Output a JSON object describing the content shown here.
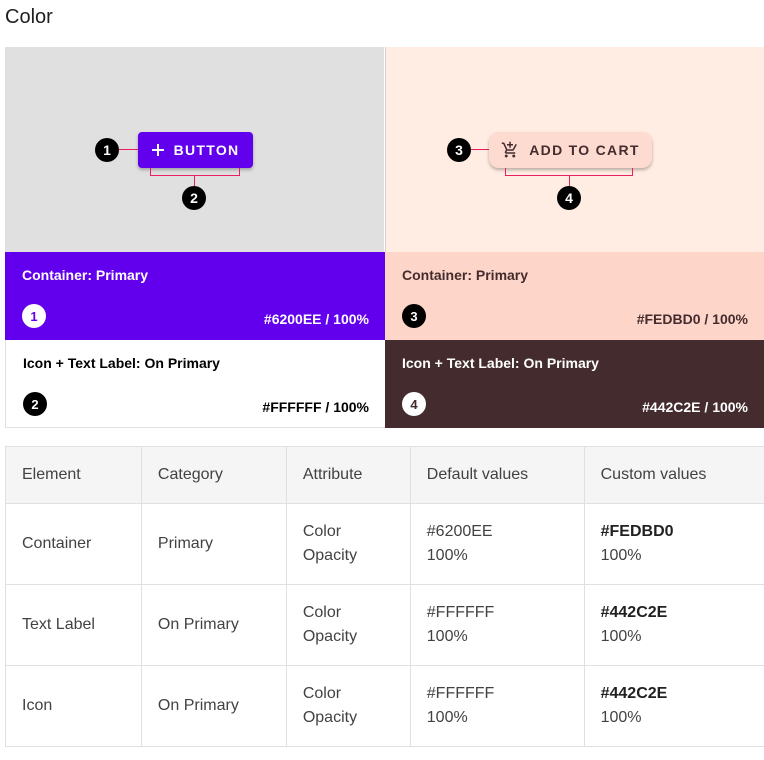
{
  "title": "Color",
  "demo": {
    "primary_button_label": "BUTTON",
    "custom_button_label": "ADD TO CART",
    "callouts": [
      "1",
      "2",
      "3",
      "4"
    ],
    "colors": {
      "primary": "#6200EE",
      "on_primary": "#FFFFFF",
      "custom_primary": "#FEDBD0",
      "custom_on_primary": "#442C2E",
      "leader": "#E91E63"
    }
  },
  "swatches": [
    {
      "label": "Container: Primary",
      "value": "#6200EE / 100%",
      "num": "1"
    },
    {
      "label": "Icon + Text Label: On Primary",
      "value": "#FFFFFF / 100%",
      "num": "2"
    },
    {
      "label": "Container: Primary",
      "value": "#FEDBD0 / 100%",
      "num": "3"
    },
    {
      "label": "Icon + Text Label: On Primary",
      "value": "#442C2E / 100%",
      "num": "4"
    }
  ],
  "table": {
    "headers": [
      "Element",
      "Category",
      "Attribute",
      "Default values",
      "Custom values"
    ],
    "rows": [
      {
        "element": "Container",
        "category": "Primary",
        "attr1": "Color",
        "attr2": "Opacity",
        "def1": "#6200EE",
        "def2": "100%",
        "cust1": "#FEDBD0",
        "cust2": "100%"
      },
      {
        "element": "Text Label",
        "category": "On Primary",
        "attr1": "Color",
        "attr2": "Opacity",
        "def1": "#FFFFFF",
        "def2": "100%",
        "cust1": "#442C2E",
        "cust2": "100%"
      },
      {
        "element": "Icon",
        "category": "On Primary",
        "attr1": "Color",
        "attr2": "Opacity",
        "def1": "#FFFFFF",
        "def2": "100%",
        "cust1": "#442C2E",
        "cust2": "100%"
      }
    ]
  }
}
